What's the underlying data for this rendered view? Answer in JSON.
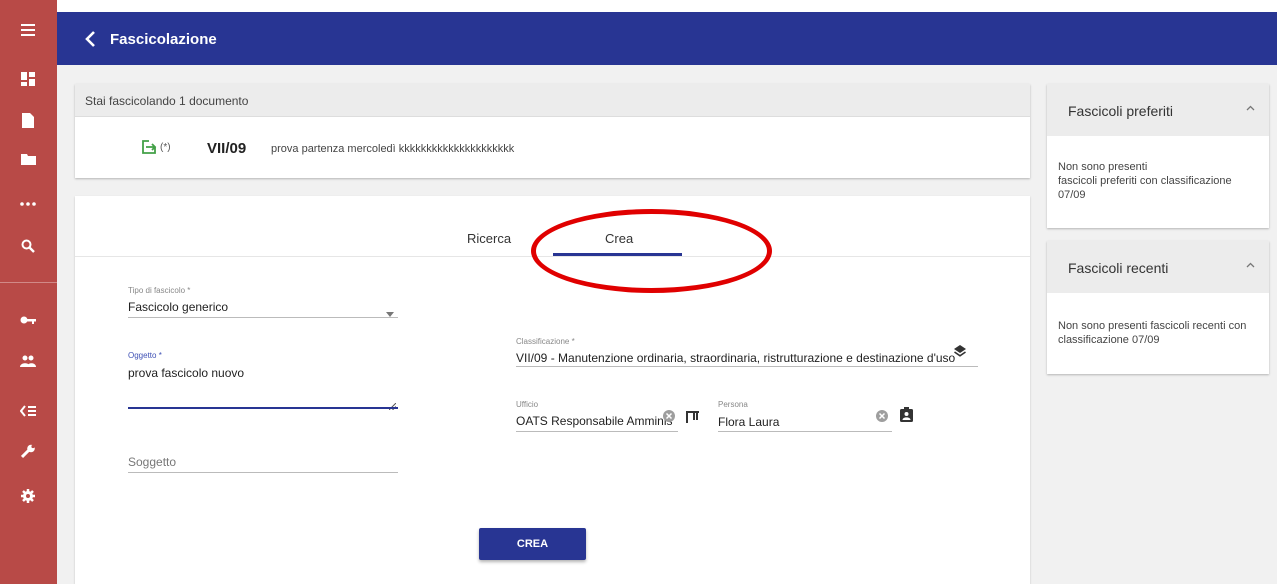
{
  "sidebar": {
    "accent": "#b84a47",
    "icons": [
      "menu-icon",
      "dashboard-icon",
      "document-icon",
      "folder-icon",
      "more-icon",
      "search-icon",
      "key-icon",
      "users-icon",
      "list-icon",
      "wrench-icon",
      "gear-icon"
    ]
  },
  "header": {
    "title": "Fascicolazione",
    "color": "#283593"
  },
  "doc_card": {
    "heading": "Stai fascicolando 1 documento",
    "star": "(*)",
    "classification": "VII/09",
    "description": "prova partenza mercoledì kkkkkkkkkkkkkkkkkkkkk"
  },
  "tabs": {
    "search": "Ricerca",
    "create": "Crea"
  },
  "form": {
    "tipo_label": "Tipo di fascicolo *",
    "tipo_value": "Fascicolo generico",
    "oggetto_label": "Oggetto *",
    "oggetto_value": "prova fascicolo nuovo",
    "soggetto_placeholder": "Soggetto",
    "classificazione_label": "Classificazione *",
    "classificazione_value": "VII/09 - Manutenzione ordinaria, straordinaria, ristrutturazione e destinazione d'uso",
    "ufficio_label": "Ufficio",
    "ufficio_value": "OATS Responsabile Amminis",
    "persona_label": "Persona",
    "persona_value": "Flora Laura",
    "submit": "CREA"
  },
  "preferiti": {
    "title": "Fascicoli preferiti",
    "line1": "Non sono presenti",
    "line2": "fascicoli preferiti con classificazione",
    "line3": "07/09"
  },
  "recenti": {
    "title": "Fascicoli recenti",
    "line1": "Non sono presenti fascicoli recenti con",
    "line2": "classificazione 07/09"
  }
}
